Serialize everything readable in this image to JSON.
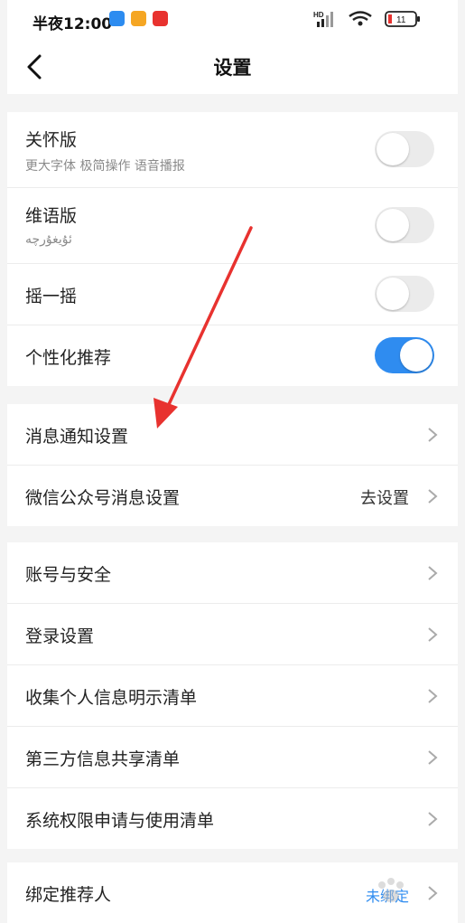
{
  "status_bar": {
    "time": "半夜12:00",
    "network": "HD",
    "battery": "11"
  },
  "header": {
    "title": "设置"
  },
  "settings_group_1": [
    {
      "label": "关怀版",
      "subtitle": "更大字体 极简操作 语音播报",
      "toggle_on": false
    },
    {
      "label": "维语版",
      "subtitle": "ئۇيغۇرچە",
      "toggle_on": false
    },
    {
      "label": "摇一摇",
      "toggle_on": false
    },
    {
      "label": "个性化推荐",
      "toggle_on": true
    }
  ],
  "settings_group_2": [
    {
      "label": "消息通知设置"
    },
    {
      "label": "微信公众号消息设置",
      "value": "去设置"
    }
  ],
  "settings_group_3": [
    {
      "label": "账号与安全"
    },
    {
      "label": "登录设置"
    },
    {
      "label": "收集个人信息明示清单"
    },
    {
      "label": "第三方信息共享清单"
    },
    {
      "label": "系统权限申请与使用清单"
    }
  ],
  "settings_group_4": [
    {
      "label": "绑定推荐人",
      "value": "未绑定"
    }
  ],
  "colors": {
    "accent": "#2f8cf0",
    "annotation_arrow": "#e8322f",
    "toggle_off": "#ebebeb"
  }
}
